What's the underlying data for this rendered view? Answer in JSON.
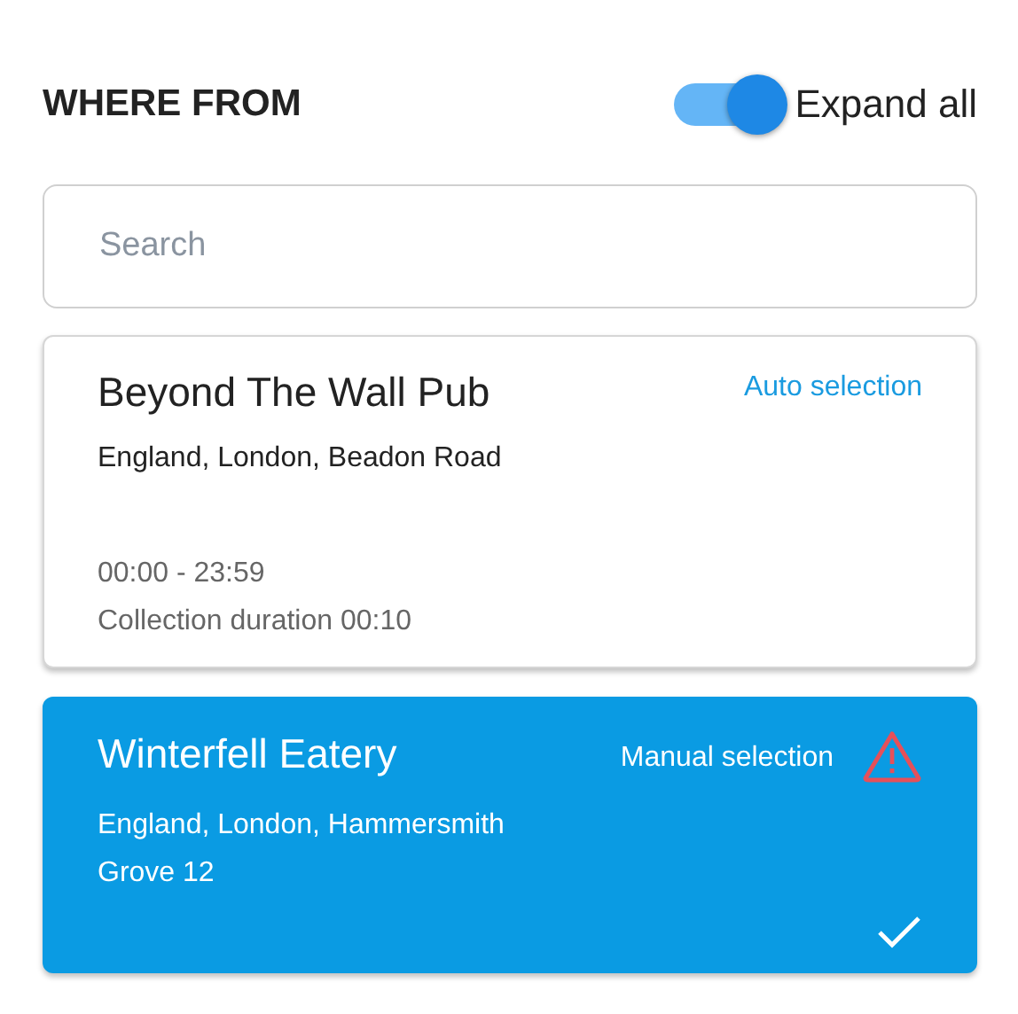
{
  "header": {
    "title": "WHERE FROM",
    "toggle": {
      "label": "Expand all",
      "on": true
    }
  },
  "search": {
    "placeholder": "Search"
  },
  "locations": [
    {
      "name": "Beyond The Wall Pub",
      "selection": "Auto selection",
      "warning": false,
      "selected": false,
      "address_lines": [
        "England, London, Beadon Road"
      ],
      "hours": "00:00 - 23:59",
      "duration": "Collection duration 00:10"
    },
    {
      "name": "Winterfell Eatery",
      "selection": "Manual selection",
      "warning": true,
      "selected": true,
      "address_lines": [
        "England, London, Hammersmith",
        "Grove 12"
      ]
    }
  ]
}
